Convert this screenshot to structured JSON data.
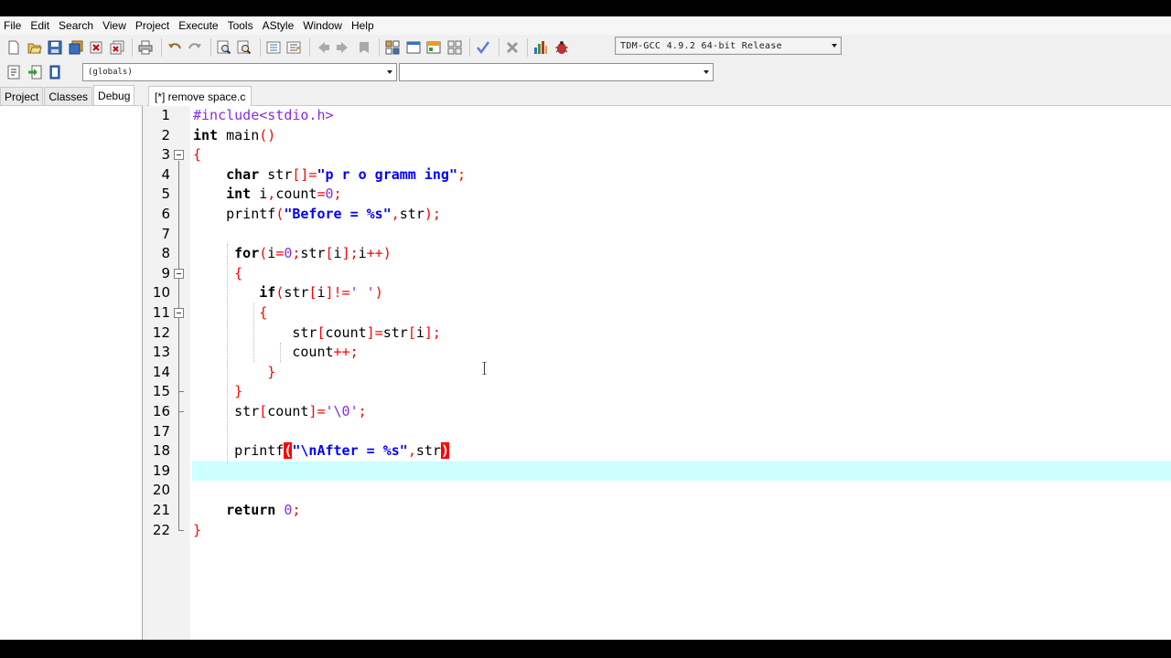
{
  "menu": [
    "File",
    "Edit",
    "Search",
    "View",
    "Project",
    "Execute",
    "Tools",
    "AStyle",
    "Window",
    "Help"
  ],
  "toolbar": {
    "compiler": "TDM-GCC 4.9.2 64-bit Release",
    "scope": "(globals)",
    "symbol": ""
  },
  "left_panel": {
    "tabs": [
      "Project",
      "Classes",
      "Debug"
    ],
    "active_tab": "Debug"
  },
  "editor": {
    "file_tab": "[*] remove space.c",
    "active_line": 18,
    "line_numbers": [
      "1",
      "2",
      "3",
      "4",
      "5",
      "6",
      "7",
      "8",
      "9",
      "10",
      "11",
      "12",
      "13",
      "14",
      "15",
      "16",
      "17",
      "18",
      "19",
      "20",
      "21",
      "22"
    ]
  },
  "code": {
    "l1": "#include<stdio.h>",
    "l2_kw": "int",
    "l2_rest": " main",
    "l4_kw": "char",
    "l4_id": " str",
    "l4_str": "\"p r o gramm ing\"",
    "l5_kw": "int",
    "l5_rest": " i",
    "l5_count": "count",
    "l5_num": "0",
    "l6_fn": "printf",
    "l6_str": "\"Before = %s\"",
    "l6_id": "str",
    "l8_kw": "for",
    "l8_i": "i",
    "l8_num": "0",
    "l8_str": "str",
    "l8_idx": "i",
    "l8_i2": "i",
    "l10_kw": "if",
    "l10_str": "str",
    "l10_idx": "i",
    "l10_char": "' '",
    "l12_a": "str",
    "l12_count": "count",
    "l12_b": "str",
    "l12_idx": "i",
    "l13_count": "count",
    "l16_str": "str",
    "l16_count": "count",
    "l16_char": "'\\0'",
    "l18_fn": "printf",
    "l18_str": "\"\\nAfter = %s\"",
    "l18_id": "str",
    "l21_kw": "return",
    "l21_num": "0"
  }
}
